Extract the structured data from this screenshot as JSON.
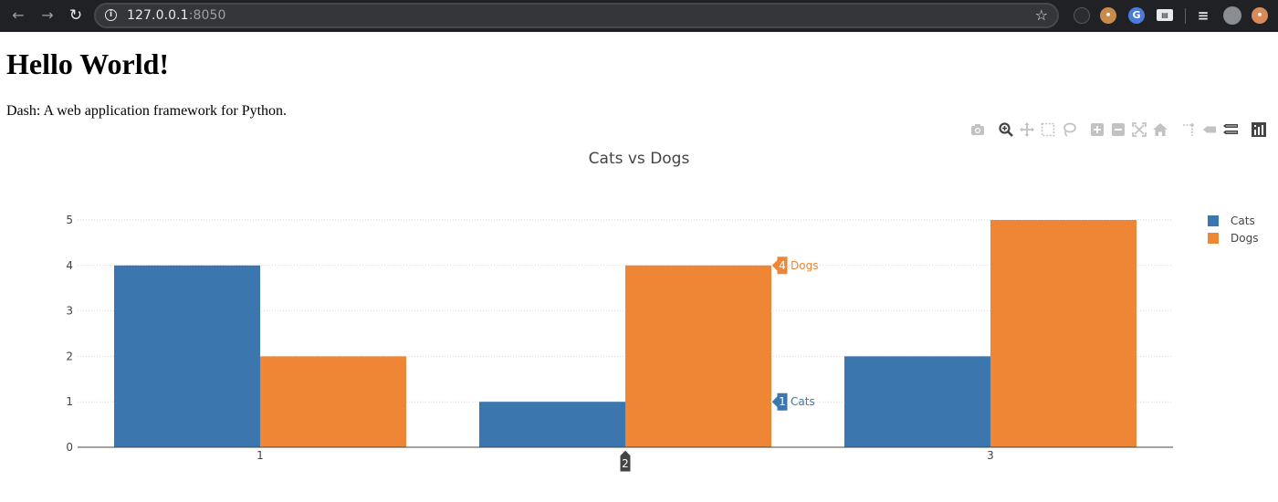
{
  "browser": {
    "url_host": "127.0.0.1",
    "url_port": ":8050"
  },
  "page": {
    "title": "Hello World!",
    "subtitle": "Dash: A web application framework for Python."
  },
  "colors": {
    "cats": "#3b76af",
    "dogs": "#ef8636",
    "grid": "#d9d9d9",
    "modebar_icon": "#c2c2c2",
    "modebar_active": "#444444",
    "chrome_bg": "#202124"
  },
  "modebar": {
    "icons": [
      "camera-icon",
      "zoom-icon",
      "pan-icon",
      "box-select-icon",
      "lasso-select-icon",
      "zoom-in-icon",
      "zoom-out-icon",
      "autoscale-icon",
      "reset-axes-icon",
      "spike-lines-icon",
      "hover-closest-icon",
      "hover-compare-icon",
      "plotly-logo-icon"
    ]
  },
  "chart_data": {
    "type": "bar",
    "title": "Cats vs Dogs",
    "xlabel": "",
    "ylabel": "",
    "categories": [
      "1",
      "2",
      "3"
    ],
    "series": [
      {
        "name": "Cats",
        "values": [
          4,
          1,
          2
        ]
      },
      {
        "name": "Dogs",
        "values": [
          2,
          4,
          5
        ]
      }
    ],
    "ylim": [
      0,
      5
    ],
    "yticks": [
      0,
      1,
      2,
      3,
      4,
      5
    ],
    "grid": true,
    "legend": "top-right",
    "hover": {
      "x_label": "2",
      "items": [
        {
          "value": "4",
          "name": "Dogs"
        },
        {
          "value": "1",
          "name": "Cats"
        }
      ]
    }
  }
}
